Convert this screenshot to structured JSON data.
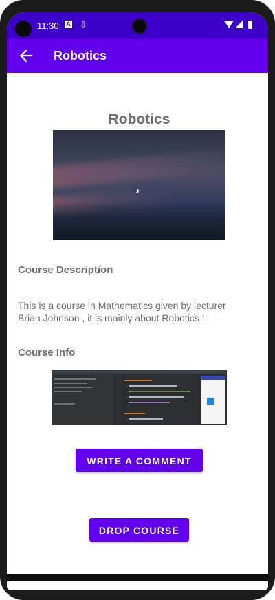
{
  "status_bar": {
    "time": "11:30",
    "icons": [
      "a-notification-icon",
      "download-icon",
      "wifi-icon",
      "signal-icon",
      "battery-icon"
    ]
  },
  "app_bar": {
    "title": "Robotics",
    "back_icon": "arrow-back-icon",
    "background": "#6200ee"
  },
  "course": {
    "title": "Robotics",
    "description_heading": "Course Description",
    "description": "This is a course in Mathematics given by lecturer Brian Johnson , it is mainly about Robotics !!",
    "info_heading": "Course Info"
  },
  "buttons": {
    "write_comment": "WRITE A COMMENT",
    "drop_course": "DROP COURSE"
  },
  "colors": {
    "status_bar": "#3c00c9",
    "primary": "#6200ee",
    "text_gray": "#6d6d6d"
  }
}
